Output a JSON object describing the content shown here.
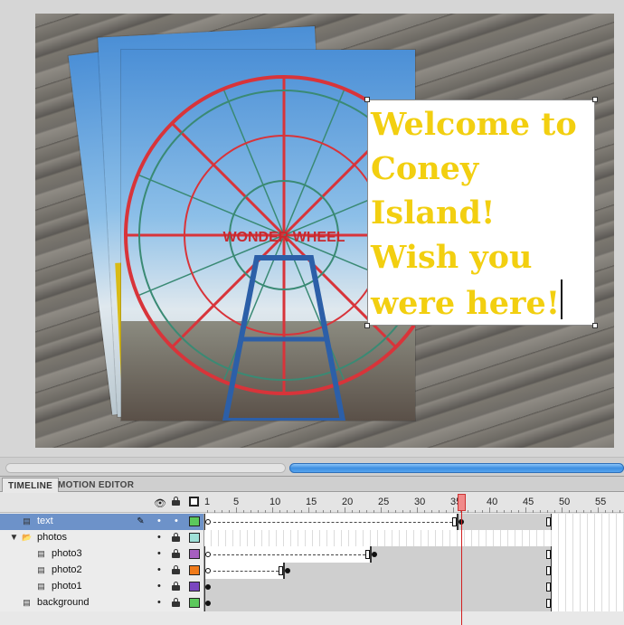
{
  "stage": {
    "text": {
      "lines": [
        "Welcome to",
        "Coney",
        "Island!",
        "Wish you",
        "were here!"
      ],
      "color": "#f2cf10"
    },
    "photo3": {
      "sign_text": "WONDER WHEEL"
    }
  },
  "panel": {
    "tabs": [
      {
        "label": "TIMELINE",
        "active": true
      },
      {
        "label": "MOTION EDITOR",
        "active": false
      }
    ],
    "header_icons": [
      "eye-icon",
      "lock-icon",
      "outline-icon"
    ],
    "ruler_labels": [
      "1",
      "5",
      "10",
      "15",
      "20",
      "25",
      "30",
      "35",
      "40",
      "45",
      "50",
      "55"
    ],
    "current_frame": 36,
    "layers": [
      {
        "name": "text",
        "selected": true,
        "type": "layer",
        "color": "#5cc85c",
        "pencil": true
      },
      {
        "name": "photos",
        "selected": false,
        "type": "folder",
        "color": "#9fe0d8"
      },
      {
        "name": "photo3",
        "selected": false,
        "type": "layer",
        "color": "#a65ec0"
      },
      {
        "name": "photo2",
        "selected": false,
        "type": "layer",
        "color": "#f07a1a"
      },
      {
        "name": "photo1",
        "selected": false,
        "type": "layer",
        "color": "#7a46c0"
      },
      {
        "name": "background",
        "selected": false,
        "type": "layer",
        "color": "#5cc85c"
      }
    ]
  }
}
